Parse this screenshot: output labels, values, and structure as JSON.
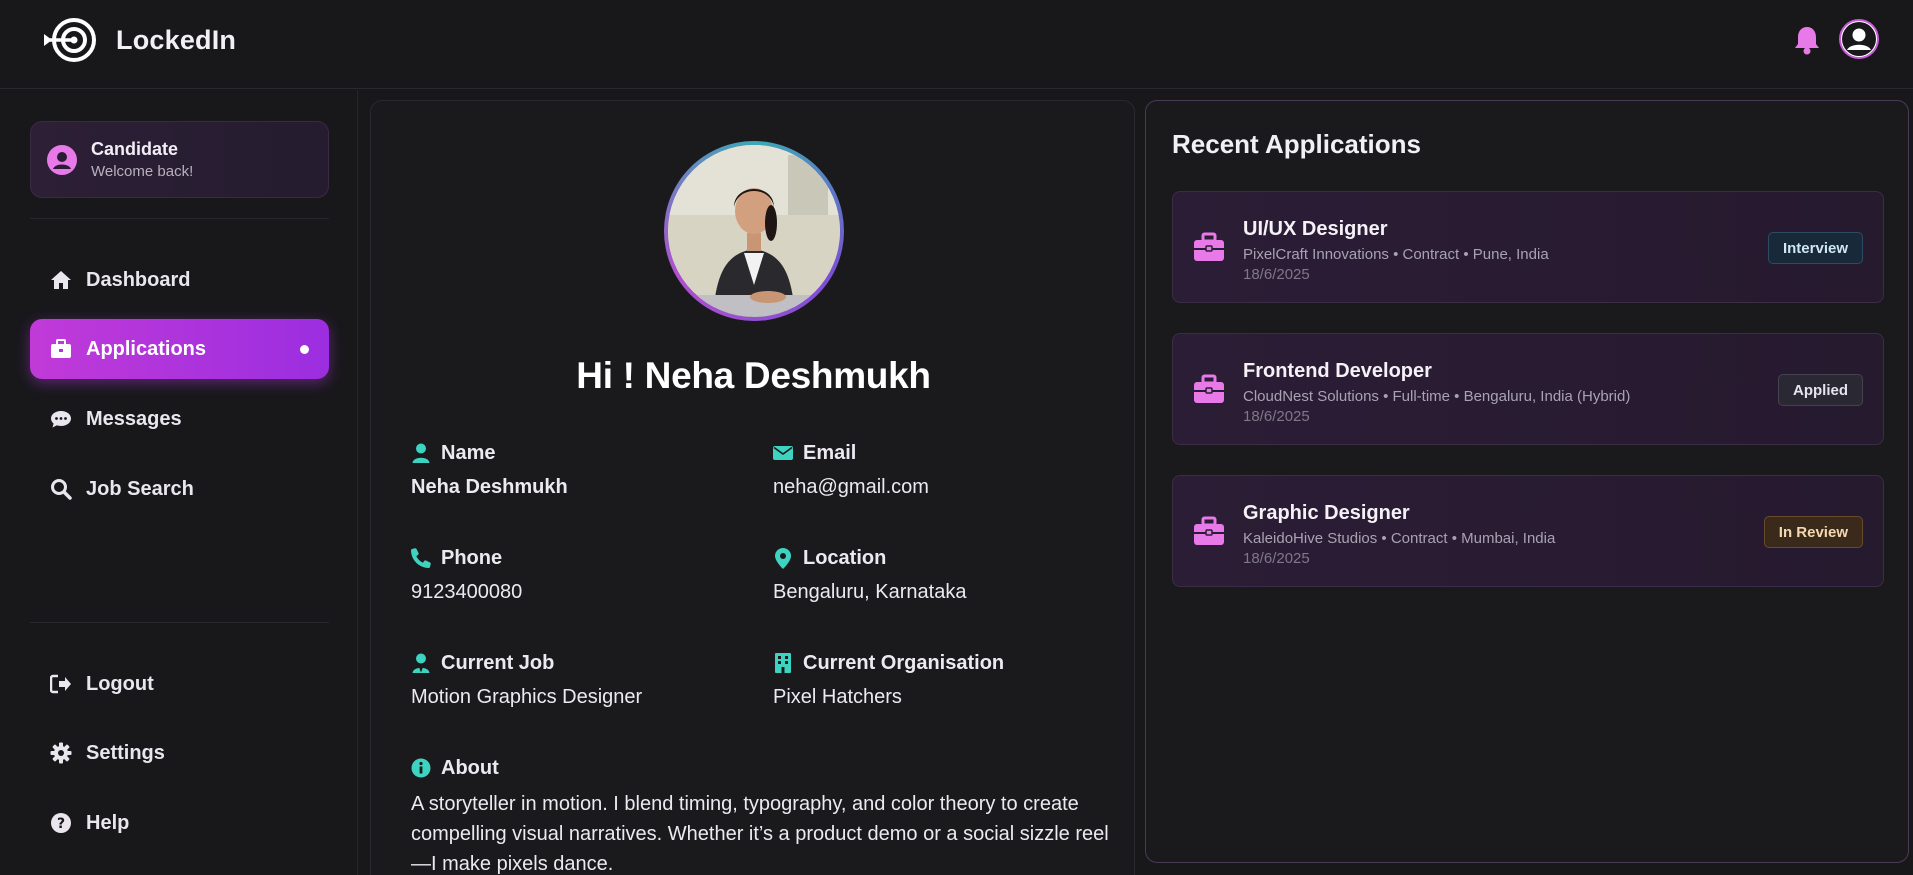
{
  "app": {
    "name": "LockedIn"
  },
  "header": {
    "bell_icon": "bell-icon",
    "avatar_icon": "user-avatar-icon"
  },
  "sidebar": {
    "candidate": {
      "title": "Candidate",
      "subtitle": "Welcome back!"
    },
    "nav": [
      {
        "label": "Dashboard",
        "icon": "home-icon",
        "active": false
      },
      {
        "label": "Applications",
        "icon": "briefcase-icon",
        "active": true
      },
      {
        "label": "Messages",
        "icon": "chat-icon",
        "active": false
      },
      {
        "label": "Job Search",
        "icon": "search-icon",
        "active": false
      }
    ],
    "bottom": [
      {
        "label": "Logout",
        "icon": "logout-icon"
      },
      {
        "label": "Settings",
        "icon": "gear-icon"
      },
      {
        "label": "Help",
        "icon": "help-icon"
      }
    ]
  },
  "profile": {
    "greeting": "Hi ! Neha Deshmukh",
    "fields": {
      "name": {
        "label": "Name",
        "value": "Neha Deshmukh"
      },
      "email": {
        "label": "Email",
        "value": "neha@gmail.com"
      },
      "phone": {
        "label": "Phone",
        "value": "9123400080"
      },
      "location": {
        "label": "Location",
        "value": "Bengaluru, Karnataka"
      },
      "current_job": {
        "label": "Current Job",
        "value": "Motion Graphics Designer"
      },
      "current_org": {
        "label": "Current Organisation",
        "value": "Pixel Hatchers"
      }
    },
    "about": {
      "label": "About",
      "text": "A storyteller in motion. I blend timing, typography, and color theory to create compelling visual narratives. Whether it’s a product demo or a social sizzle reel—I make pixels dance."
    }
  },
  "recent_applications": {
    "title": "Recent Applications",
    "items": [
      {
        "title": "UI/UX Designer",
        "meta": "PixelCraft Innovations • Contract • Pune, India",
        "date": "18/6/2025",
        "status": "Interview"
      },
      {
        "title": "Frontend Developer",
        "meta": "CloudNest Solutions • Full-time • Bengaluru, India (Hybrid)",
        "date": "18/6/2025",
        "status": "Applied"
      },
      {
        "title": "Graphic Designer",
        "meta": "KaleidoHive Studios • Contract • Mumbai, India",
        "date": "18/6/2025",
        "status": "In Review"
      }
    ]
  },
  "colors": {
    "accent": "#c13ad8",
    "teal": "#3dd3c0",
    "pink_icon": "#e879e8",
    "background": "#18181b"
  }
}
